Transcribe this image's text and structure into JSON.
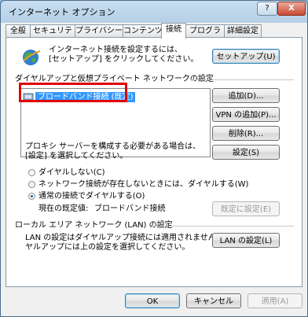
{
  "window": {
    "title": "インターネット オプション",
    "help_label": "?",
    "close_label": "X"
  },
  "tabs": [
    {
      "label": "全般"
    },
    {
      "label": "セキュリティ"
    },
    {
      "label": "プライバシー"
    },
    {
      "label": "コンテンツ"
    },
    {
      "label": "接続",
      "active": true
    },
    {
      "label": "プログラム"
    },
    {
      "label": "詳細設定"
    }
  ],
  "setup": {
    "text_line1": "インターネット接続を設定するには、",
    "text_line2": "[セットアップ] をクリックしてください。",
    "button": "セットアップ(U)"
  },
  "dialup": {
    "heading": "ダイヤルアップと仮想プライベート ネットワークの設定",
    "list_items": [
      "ブロードバンド接続 (既定)"
    ],
    "add_button": "追加(D)...",
    "add_vpn_button": "VPN の追加(P)...",
    "remove_button": "削除(R)...",
    "settings_button": "設定(S)"
  },
  "proxy": {
    "text_line1": "プロキシ サーバーを構成する必要がある場合は、",
    "text_line2": "[設定] を選択してください。"
  },
  "dial_options": {
    "never": "ダイヤルしない(C)",
    "when_no_network": "ネットワーク接続が存在しないときには、ダイヤルする(W)",
    "always": "通常の接続でダイヤルする(O)",
    "selected": "always",
    "default_label": "現在の既定値:",
    "default_value": "ブロードバンド接続",
    "set_default_button": "既定に設定(E)"
  },
  "lan": {
    "heading": "ローカル エリア ネットワーク (LAN) の設定",
    "text_line1": "LAN の設定はダイヤルアップ接続には適用されません。ダイ",
    "text_line2": "ヤルアップには上の設定を選択してください。",
    "button": "LAN の設定(L)"
  },
  "footer": {
    "ok": "OK",
    "cancel": "キャンセル",
    "apply": "適用(A)"
  },
  "colors": {
    "highlight_border": "#e00000",
    "selection": "#3399ff"
  }
}
